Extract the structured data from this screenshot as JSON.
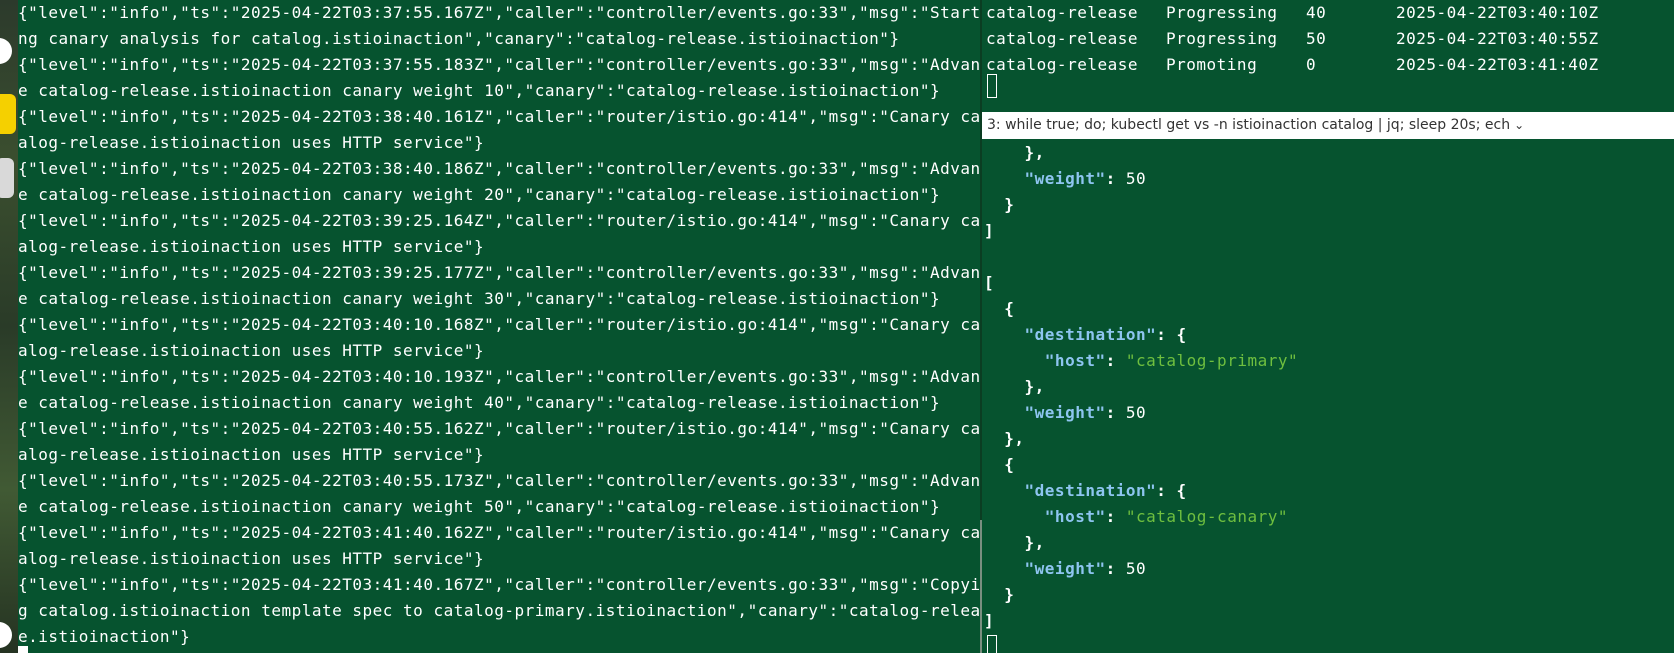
{
  "left_pane": {
    "lines": [
      "{\"level\":\"info\",\"ts\":\"2025-04-22T03:37:55.167Z\",\"caller\":\"controller/events.go:33\",\"msg\":\"Starti",
      "ng canary analysis for catalog.istioinaction\",\"canary\":\"catalog-release.istioinaction\"}",
      "{\"level\":\"info\",\"ts\":\"2025-04-22T03:37:55.183Z\",\"caller\":\"controller/events.go:33\",\"msg\":\"Advanc",
      "e catalog-release.istioinaction canary weight 10\",\"canary\":\"catalog-release.istioinaction\"}",
      "{\"level\":\"info\",\"ts\":\"2025-04-22T03:38:40.161Z\",\"caller\":\"router/istio.go:414\",\"msg\":\"Canary cat",
      "alog-release.istioinaction uses HTTP service\"}",
      "{\"level\":\"info\",\"ts\":\"2025-04-22T03:38:40.186Z\",\"caller\":\"controller/events.go:33\",\"msg\":\"Advanc",
      "e catalog-release.istioinaction canary weight 20\",\"canary\":\"catalog-release.istioinaction\"}",
      "{\"level\":\"info\",\"ts\":\"2025-04-22T03:39:25.164Z\",\"caller\":\"router/istio.go:414\",\"msg\":\"Canary cat",
      "alog-release.istioinaction uses HTTP service\"}",
      "{\"level\":\"info\",\"ts\":\"2025-04-22T03:39:25.177Z\",\"caller\":\"controller/events.go:33\",\"msg\":\"Advanc",
      "e catalog-release.istioinaction canary weight 30\",\"canary\":\"catalog-release.istioinaction\"}",
      "{\"level\":\"info\",\"ts\":\"2025-04-22T03:40:10.168Z\",\"caller\":\"router/istio.go:414\",\"msg\":\"Canary cat",
      "alog-release.istioinaction uses HTTP service\"}",
      "{\"level\":\"info\",\"ts\":\"2025-04-22T03:40:10.193Z\",\"caller\":\"controller/events.go:33\",\"msg\":\"Advanc",
      "e catalog-release.istioinaction canary weight 40\",\"canary\":\"catalog-release.istioinaction\"}",
      "{\"level\":\"info\",\"ts\":\"2025-04-22T03:40:55.162Z\",\"caller\":\"router/istio.go:414\",\"msg\":\"Canary cat",
      "alog-release.istioinaction uses HTTP service\"}",
      "{\"level\":\"info\",\"ts\":\"2025-04-22T03:40:55.173Z\",\"caller\":\"controller/events.go:33\",\"msg\":\"Advanc",
      "e catalog-release.istioinaction canary weight 50\",\"canary\":\"catalog-release.istioinaction\"}",
      "{\"level\":\"info\",\"ts\":\"2025-04-22T03:41:40.162Z\",\"caller\":\"router/istio.go:414\",\"msg\":\"Canary cat",
      "alog-release.istioinaction uses HTTP service\"}",
      "{\"level\":\"info\",\"ts\":\"2025-04-22T03:41:40.167Z\",\"caller\":\"controller/events.go:33\",\"msg\":\"Copyin",
      "g catalog.istioinaction template spec to catalog-primary.istioinaction\",\"canary\":\"catalog-releas",
      "e.istioinaction\"}"
    ]
  },
  "right_top": {
    "rows": [
      {
        "name": "catalog-release",
        "status": "Progressing",
        "weight": "40",
        "time": "2025-04-22T03:40:10Z"
      },
      {
        "name": "catalog-release",
        "status": "Progressing",
        "weight": "50",
        "time": "2025-04-22T03:40:55Z"
      },
      {
        "name": "catalog-release",
        "status": "Promoting",
        "weight": "0",
        "time": "2025-04-22T03:41:40Z"
      }
    ]
  },
  "pane_title": {
    "label": "3: while true; do; kubectl get vs -n istioinaction catalog  | jq; sleep 20s; ech",
    "chevron_icon": "chevron-down-icon"
  },
  "right_bottom": {
    "lines": [
      [
        {
          "t": "    },",
          "c": "jpunct"
        }
      ],
      [
        {
          "t": "    ",
          "c": ""
        },
        {
          "t": "\"weight\"",
          "c": "jkey"
        },
        {
          "t": ": ",
          "c": "jpunct"
        },
        {
          "t": "50",
          "c": "jnum"
        }
      ],
      [
        {
          "t": "  }",
          "c": "jpunct"
        }
      ],
      [
        {
          "t": "]",
          "c": "jpunct"
        }
      ],
      [
        {
          "t": "",
          "c": ""
        }
      ],
      [
        {
          "t": "[",
          "c": "jpunct"
        }
      ],
      [
        {
          "t": "  {",
          "c": "jpunct"
        }
      ],
      [
        {
          "t": "    ",
          "c": ""
        },
        {
          "t": "\"destination\"",
          "c": "jkey"
        },
        {
          "t": ": {",
          "c": "jpunct"
        }
      ],
      [
        {
          "t": "      ",
          "c": ""
        },
        {
          "t": "\"host\"",
          "c": "jkey"
        },
        {
          "t": ": ",
          "c": "jpunct"
        },
        {
          "t": "\"catalog-primary\"",
          "c": "jstr"
        }
      ],
      [
        {
          "t": "    },",
          "c": "jpunct"
        }
      ],
      [
        {
          "t": "    ",
          "c": ""
        },
        {
          "t": "\"weight\"",
          "c": "jkey"
        },
        {
          "t": ": ",
          "c": "jpunct"
        },
        {
          "t": "50",
          "c": "jnum"
        }
      ],
      [
        {
          "t": "  },",
          "c": "jpunct"
        }
      ],
      [
        {
          "t": "  {",
          "c": "jpunct"
        }
      ],
      [
        {
          "t": "    ",
          "c": ""
        },
        {
          "t": "\"destination\"",
          "c": "jkey"
        },
        {
          "t": ": {",
          "c": "jpunct"
        }
      ],
      [
        {
          "t": "      ",
          "c": ""
        },
        {
          "t": "\"host\"",
          "c": "jkey"
        },
        {
          "t": ": ",
          "c": "jpunct"
        },
        {
          "t": "\"catalog-canary\"",
          "c": "jstr"
        }
      ],
      [
        {
          "t": "    },",
          "c": "jpunct"
        }
      ],
      [
        {
          "t": "    ",
          "c": ""
        },
        {
          "t": "\"weight\"",
          "c": "jkey"
        },
        {
          "t": ": ",
          "c": "jpunct"
        },
        {
          "t": "50",
          "c": "jnum"
        }
      ],
      [
        {
          "t": "  }",
          "c": "jpunct"
        }
      ],
      [
        {
          "t": "]",
          "c": "jpunct"
        }
      ]
    ]
  },
  "colors": {
    "terminal_bg": "#06532f",
    "json_key": "#8ec5f0",
    "json_string": "#6fbf3f",
    "titlebar_bg": "#ffffff"
  }
}
